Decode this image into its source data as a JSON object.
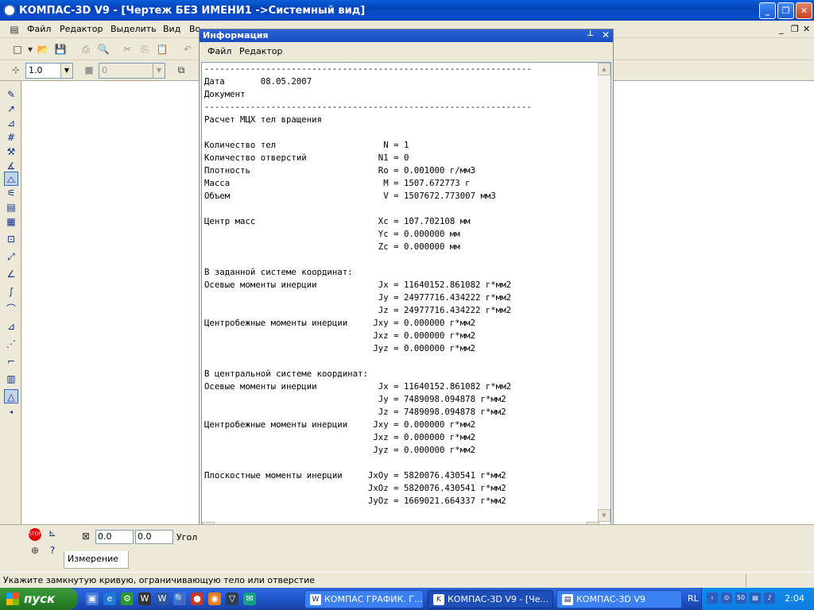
{
  "window": {
    "title": "КОМПАС-3D V9 - [Чертеж БЕЗ ИМЕНИ1 ->Системный вид]"
  },
  "menubar": {
    "items": [
      "Файл",
      "Редактор",
      "Выделить",
      "Вид",
      "Во"
    ]
  },
  "toolbar": {
    "scale_value": "1.0",
    "layer_value": "0"
  },
  "info_window": {
    "title": "Информация",
    "menu": [
      "Файл",
      "Редактор"
    ],
    "lines": [
      "----------------------------------------------------------------",
      "Дата       08.05.2007",
      "Документ",
      "----------------------------------------------------------------",
      "Расчет МЦХ тел вращения",
      "",
      "Количество тел                     N = 1",
      "Количество отверстий              N1 = 0",
      "Плотность                         Ro = 0.001000 г/мм3",
      "Масса                              M = 1507.672773 г",
      "Объем                              V = 1507672.773007 мм3",
      "",
      "Центр масс                        Xc = 107.702108 мм",
      "                                  Yc = 0.000000 мм",
      "                                  Zc = 0.000000 мм",
      "",
      "В заданной системе координат:",
      "Осевые моменты инерции            Jx = 11640152.861082 г*мм2",
      "                                  Jy = 24977716.434222 г*мм2",
      "                                  Jz = 24977716.434222 г*мм2",
      "Центробежные моменты инерции     Jxy = 0.000000 г*мм2",
      "                                 Jxz = 0.000000 г*мм2",
      "                                 Jyz = 0.000000 г*мм2",
      "",
      "В центральной системе координат:",
      "Осевые моменты инерции            Jx = 11640152.861082 г*мм2",
      "                                  Jy = 7489098.094878 г*мм2",
      "                                  Jz = 7489098.094878 г*мм2",
      "Центробежные моменты инерции     Jxy = 0.000000 г*мм2",
      "                                 Jxz = 0.000000 г*мм2",
      "                                 Jyz = 0.000000 г*мм2",
      "",
      "Плоскостные моменты инерции     JxOy = 5820076.430541 г*мм2",
      "                                JxOz = 5820076.430541 г*мм2",
      "                                JyOz = 1669021.664337 г*мм2"
    ]
  },
  "bottom_panel": {
    "x_value": "0.0",
    "y_value": "0.0",
    "angle_label": "Угол",
    "tab_label": "Измерение"
  },
  "statusbar": {
    "message": "Укажите замкнутую кривую, ограничивающую тело или отверстие"
  },
  "taskbar": {
    "start_label": "пуск",
    "tasks": [
      "КОМПАС ГРАФИК. Г...",
      "КОМПАС-3D V9 - [Че...",
      "КОМПАС-3D V9"
    ],
    "lang": "RL",
    "clock": "2:04",
    "tray_num": "50"
  },
  "colors": {
    "titlebar": "#0542b8",
    "taskbar": "#245edb",
    "start_button": "#2d8a2d",
    "face": "#ece9d8"
  }
}
